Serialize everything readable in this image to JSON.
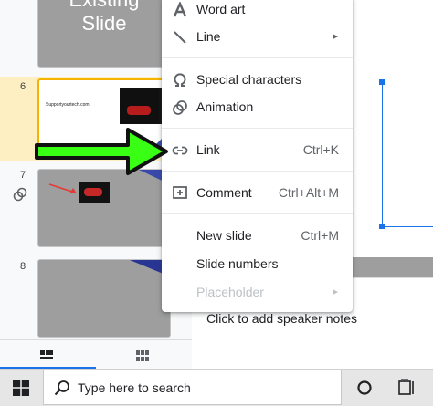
{
  "filmstrip": {
    "slides": [
      {
        "number": "",
        "title": "Existing\nSlide"
      },
      {
        "number": "6",
        "text": "Supportyourtech.com"
      },
      {
        "number": "7"
      },
      {
        "number": "8"
      }
    ]
  },
  "context_menu": {
    "items": [
      {
        "label": "Word art",
        "icon": "word-art-icon"
      },
      {
        "label": "Line",
        "icon": "line-icon",
        "submenu": "►"
      },
      {
        "label": "Special characters",
        "icon": "omega-icon"
      },
      {
        "label": "Animation",
        "icon": "animation-icon"
      },
      {
        "label": "Link",
        "icon": "link-icon",
        "shortcut": "Ctrl+K"
      },
      {
        "label": "Comment",
        "icon": "comment-icon",
        "shortcut": "Ctrl+Alt+M"
      },
      {
        "label": "New slide",
        "shortcut": "Ctrl+M"
      },
      {
        "label": "Slide numbers"
      },
      {
        "label": "Placeholder",
        "submenu": "►",
        "disabled": true
      }
    ]
  },
  "speaker_notes": {
    "placeholder": "Click to add speaker notes"
  },
  "taskbar": {
    "search_placeholder": "Type here to search"
  },
  "colors": {
    "selected_row": "#feefc3",
    "selection_handle": "#1a73e8",
    "annotation_arrow": "#39ff14",
    "disabled_text": "#bdc1c6"
  }
}
